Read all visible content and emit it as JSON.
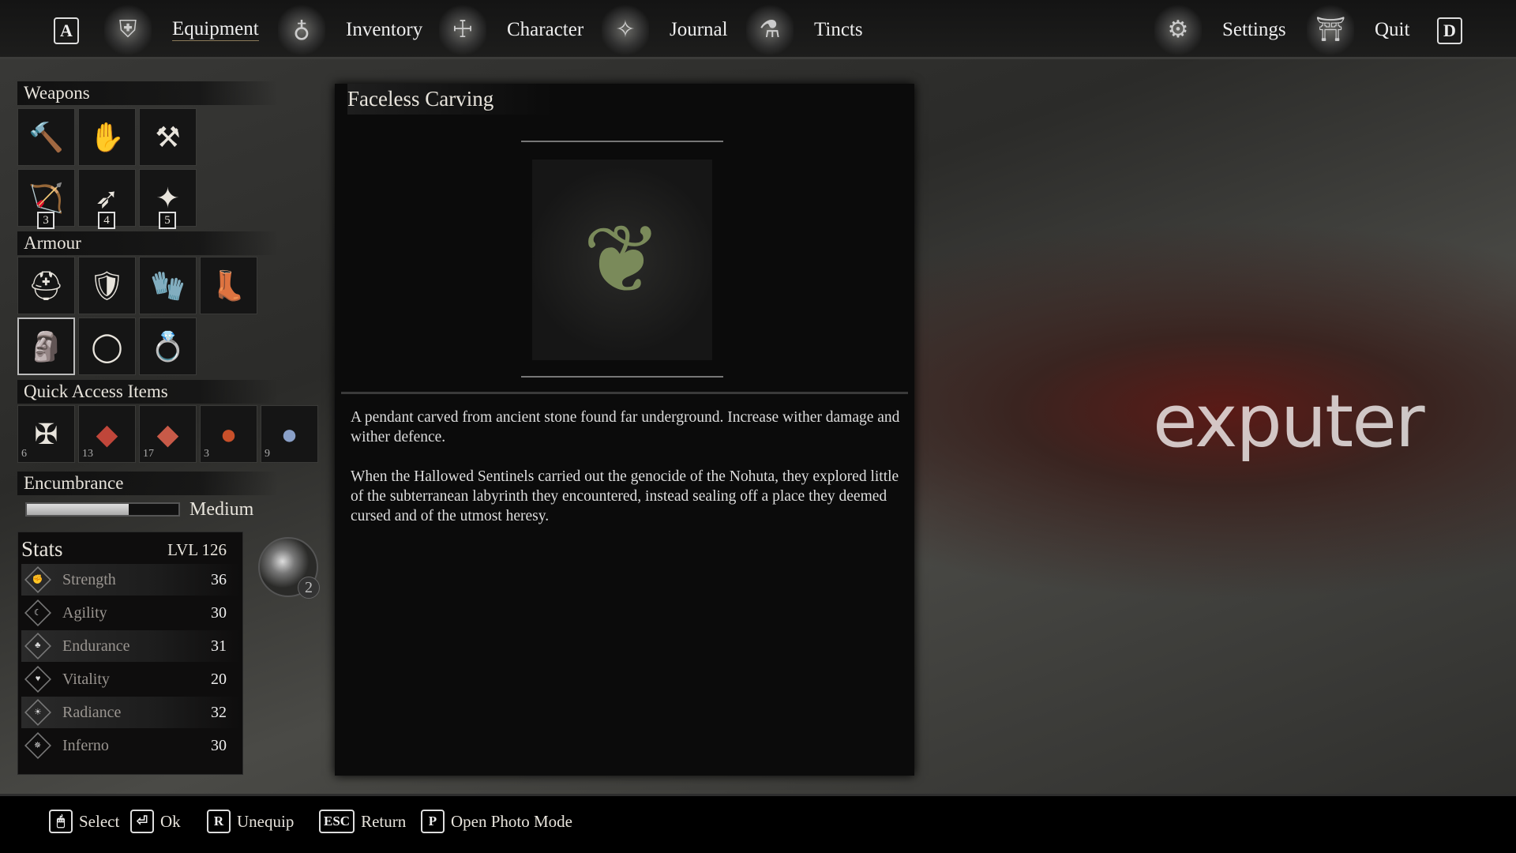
{
  "nav": {
    "left_key": "A",
    "right_key": "D",
    "items": [
      {
        "label": "Equipment",
        "icon": "shield-icon",
        "active": true
      },
      {
        "label": "Inventory",
        "icon": "pouch-icon"
      },
      {
        "label": "Character",
        "icon": "character-icon"
      },
      {
        "label": "Journal",
        "icon": "journal-icon"
      },
      {
        "label": "Tincts",
        "icon": "tincts-icon"
      }
    ],
    "right_items": [
      {
        "label": "Settings",
        "icon": "gear-icon"
      },
      {
        "label": "Quit",
        "icon": "door-icon"
      }
    ]
  },
  "weapons": {
    "title": "Weapons",
    "slots": [
      {
        "glyph": "🔨"
      },
      {
        "glyph": "✋"
      },
      {
        "glyph": "⚒"
      },
      {
        "glyph": "🏹",
        "badge": "3"
      },
      {
        "glyph": "➶",
        "badge": "4"
      },
      {
        "glyph": "✦",
        "badge": "5"
      }
    ]
  },
  "armour": {
    "title": "Armour",
    "slots": [
      {
        "glyph": "⛑"
      },
      {
        "glyph": "🛡"
      },
      {
        "glyph": "🧤"
      },
      {
        "glyph": "👢"
      },
      {
        "glyph": "🗿",
        "selected": true
      },
      {
        "glyph": "◯"
      },
      {
        "glyph": "💍"
      }
    ]
  },
  "quick": {
    "title": "Quick Access Items",
    "slots": [
      {
        "glyph": "✠",
        "count": "6"
      },
      {
        "glyph": "◆",
        "count": "13",
        "color": "#c0463a"
      },
      {
        "glyph": "◆",
        "count": "17",
        "color": "#c85a48"
      },
      {
        "glyph": "●",
        "count": "3",
        "color": "#c8502a"
      },
      {
        "glyph": "●",
        "count": "9",
        "color": "#8aa0c8"
      }
    ]
  },
  "encumbrance": {
    "title": "Encumbrance",
    "level": "Medium",
    "fill_percent": 67
  },
  "stats": {
    "title": "Stats",
    "level": "LVL 126",
    "points": "2",
    "rows": [
      {
        "name": "Strength",
        "value": "36",
        "icon": "fist-icon"
      },
      {
        "name": "Agility",
        "value": "30",
        "icon": "boot-icon"
      },
      {
        "name": "Endurance",
        "value": "31",
        "icon": "armor-icon"
      },
      {
        "name": "Vitality",
        "value": "20",
        "icon": "heart-icon"
      },
      {
        "name": "Radiance",
        "value": "32",
        "icon": "sun-icon"
      },
      {
        "name": "Inferno",
        "value": "30",
        "icon": "flame-icon"
      }
    ]
  },
  "detail": {
    "title": "Faceless Carving",
    "para1": "A pendant carved from ancient stone found far underground. Increase wither damage and wither defence.",
    "para2": "When the Hallowed Sentinels carried out the genocide of the Nohuta, they explored little of the subterranean labyrinth they encountered, instead sealing off a place they deemed cursed and of the utmost heresy."
  },
  "watermark": "exputer",
  "hints": [
    {
      "key": "🖱",
      "label": "Select"
    },
    {
      "key": "⏎",
      "label": "Ok"
    },
    {
      "key": "R",
      "label": "Unequip"
    },
    {
      "key": "ESC",
      "label": "Return"
    },
    {
      "key": "P",
      "label": "Open Photo Mode"
    }
  ]
}
